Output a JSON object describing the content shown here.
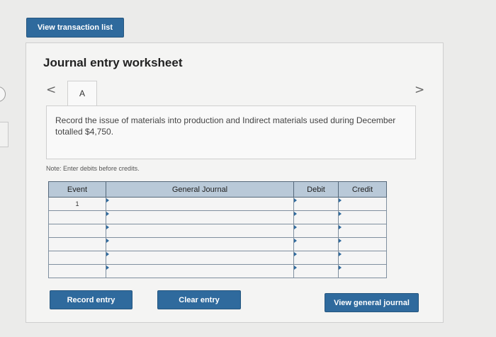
{
  "top_button": {
    "label": "View transaction list"
  },
  "worksheet": {
    "title": "Journal entry worksheet",
    "prev_glyph": "<",
    "next_glyph": ">",
    "tab_label": "A",
    "description": "Record the issue of materials into production and Indirect materials used during December totalled $4,750.",
    "note": "Note: Enter debits before credits."
  },
  "table": {
    "headers": {
      "event": "Event",
      "general_journal": "General Journal",
      "debit": "Debit",
      "credit": "Credit"
    },
    "rows": [
      {
        "event": "1",
        "account": "",
        "debit": "",
        "credit": ""
      },
      {
        "event": "",
        "account": "",
        "debit": "",
        "credit": ""
      },
      {
        "event": "",
        "account": "",
        "debit": "",
        "credit": ""
      },
      {
        "event": "",
        "account": "",
        "debit": "",
        "credit": ""
      },
      {
        "event": "",
        "account": "",
        "debit": "",
        "credit": ""
      },
      {
        "event": "",
        "account": "",
        "debit": "",
        "credit": ""
      }
    ]
  },
  "actions": {
    "record": "Record entry",
    "clear": "Clear entry",
    "view_journal": "View general journal"
  },
  "colors": {
    "accent": "#2f6a9d",
    "header": "#b9c9d8"
  }
}
